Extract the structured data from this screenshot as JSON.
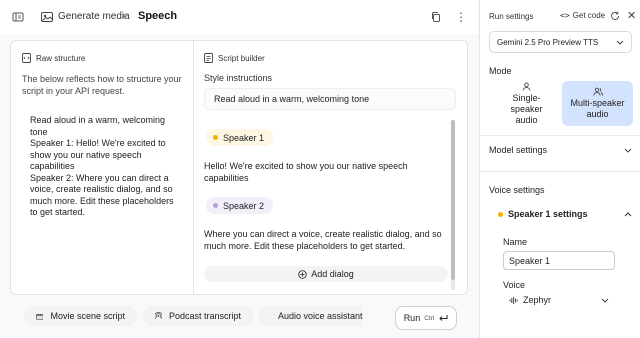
{
  "header": {
    "parent": "Generate media",
    "separator": "›",
    "title": "Speech",
    "more": "⋮"
  },
  "raw_structure": {
    "title": "Raw structure",
    "description": "The below reflects how to structure your script in your API request.",
    "body": "Read aloud in a warm, welcoming tone\nSpeaker 1: Hello! We're excited to show you our native speech capabilities\nSpeaker 2: Where you can direct a voice, create realistic dialog, and so much more. Edit these placeholders to get started."
  },
  "script_builder": {
    "title": "Script builder",
    "style_label": "Style instructions",
    "style_value": "Read aloud in a warm, welcoming tone",
    "dialogs": [
      {
        "speaker": "Speaker 1",
        "color": "#f0b400",
        "text": "Hello! We're excited to show you our native speech capabilities"
      },
      {
        "speaker": "Speaker 2",
        "color": "#b89ddc",
        "text": "Where you can direct a voice, create realistic dialog, and so much more. Edit these placeholders to get started."
      }
    ],
    "add_dialog": "Add dialog"
  },
  "bottom": {
    "prompts": [
      "Movie scene script",
      "Podcast transcript",
      "Audio voice assistant"
    ],
    "run": "Run",
    "run_shortcut": "Ctrl"
  },
  "run_settings": {
    "title": "Run settings",
    "get_code": "Get code",
    "close": "✕",
    "model": "Gemini 2.5 Pro Preview TTS",
    "mode_label": "Mode",
    "mode_single": "Single-speaker audio",
    "mode_multi": "Multi-speaker audio",
    "model_settings": "Model settings",
    "voice_settings": "Voice settings",
    "speaker_settings": "Speaker 1 settings",
    "name_label": "Name",
    "name_value": "Speaker 1",
    "voice_label": "Voice",
    "voice_value": "Zephyr"
  },
  "colors": {
    "accent_selected": "#d3e3fd",
    "speaker1": "#f0b400",
    "speaker2": "#b89ddc"
  }
}
